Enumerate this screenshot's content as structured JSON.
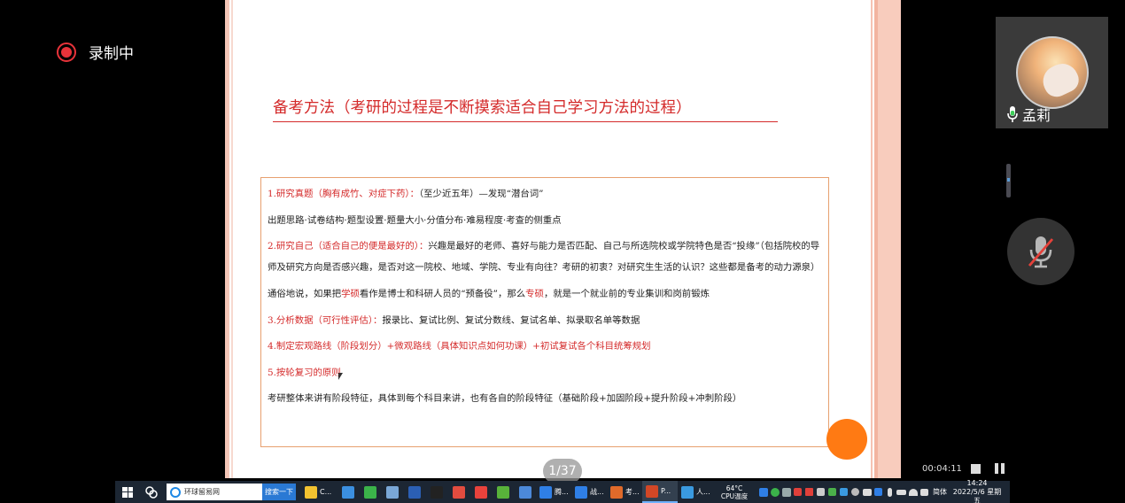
{
  "recording": {
    "label": "录制中",
    "indicator_color": "#e8333a"
  },
  "slide": {
    "title": "备考方法（考研的过程是不断摸索适合自己学习方法的过程）",
    "title_color": "#d42a2a",
    "page_indicator": "1/37",
    "lines": {
      "l1_red": "1.研究真题（胸有成竹、对症下药）：",
      "l1_black": "（至少近五年）—发现“潜台词”",
      "l2": "出题思路·试卷结构·题型设置·题量大小·分值分布·难易程度·考查的侧重点",
      "l3_red": "2.研究自己（适合自己的便是最好的）：",
      "l3_black": "兴趣是最好的老师、喜好与能力是否匹配、自己与所选院校或学院特色是否“投缘”（包括院校的导师及研究方向是否感兴趣，是否对这一院校、地域、学院、专业有向往？考研的初衷？对研究生生活的认识？这些都是备考的动力源泉）",
      "l4_a": "通俗地说，如果把",
      "l4_b": "学硕",
      "l4_c": "看作是博士和科研人员的“预备役”，那么",
      "l4_d": "专硕",
      "l4_e": "，就是一个就业前的专业集训和岗前锻炼",
      "l5_red": "3.分析数据（可行性评估）：",
      "l5_black": "报录比、复试比例、复试分数线、复试名单、拟录取名单等数据",
      "l6": "4.制定宏观路线（阶段划分）+微观路线（具体知识点如何功课）+初试复试各个科目统筹规划",
      "l7": "5.按轮复习的原则",
      "l8": "考研整体来讲有阶段特征，具体到每个科目来讲，也有各自的阶段特征（基础阶段+加固阶段+提升阶段+冲刺阶段）"
    }
  },
  "participant": {
    "name": "孟莉"
  },
  "controls": {
    "recording_time": "00:04:11"
  },
  "taskbar": {
    "search_text": "环球留易网",
    "search_button": "搜索一下",
    "apps": [
      {
        "icon": "folder-icon",
        "label": "C...",
        "color": "#f2c230"
      },
      {
        "icon": "mail-icon",
        "label": "",
        "color": "#3b8fe0"
      },
      {
        "icon": "refresh-icon",
        "label": "",
        "color": "#3bb34a"
      },
      {
        "icon": "calendar-icon",
        "label": "",
        "color": "#7aa7d6"
      },
      {
        "icon": "word-icon",
        "label": "",
        "color": "#2b5fb4"
      },
      {
        "icon": "penguin-icon",
        "label": "",
        "color": "#222222"
      },
      {
        "icon": "chrome-icon",
        "label": "",
        "color": "#e24c3f"
      },
      {
        "icon": "app-red-icon",
        "label": "",
        "color": "#e8423c"
      },
      {
        "icon": "app-green-icon",
        "label": "",
        "color": "#58b23a"
      },
      {
        "icon": "app-blue-icon",
        "label": "",
        "color": "#4c89d9"
      },
      {
        "icon": "tencent-meeting-icon",
        "label": "腾...",
        "color": "#2f7fe6"
      },
      {
        "icon": "tencent-meeting-icon",
        "label": "战...",
        "color": "#2f7fe6"
      },
      {
        "icon": "slides-icon",
        "label": "考...",
        "color": "#e06a2a"
      },
      {
        "icon": "powerpoint-icon",
        "label": "P...",
        "color": "#d24726"
      },
      {
        "icon": "video-icon",
        "label": "人...",
        "color": "#3a9ae0"
      }
    ],
    "weather": {
      "temp": "64°C",
      "desc": "CPU温度"
    },
    "ime": "简体",
    "time": "14:24",
    "date": "2022/5/6 星期五"
  },
  "colors": {
    "accent_orange": "#ff7a13",
    "box_border": "#e7a06f"
  }
}
